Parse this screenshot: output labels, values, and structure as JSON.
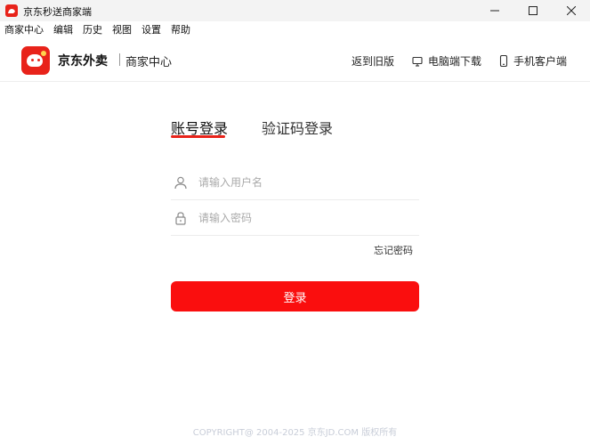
{
  "window": {
    "title": "京东秒送商家端",
    "controls": [
      "minimize-icon",
      "maximize-icon",
      "close-icon"
    ]
  },
  "menu": {
    "items": [
      "商家中心",
      "编辑",
      "历史",
      "视图",
      "设置",
      "帮助"
    ]
  },
  "header": {
    "brand": "京东外卖",
    "subtitle": "商家中心",
    "links": {
      "old_version": "返到旧版",
      "desktop_download": "电脑端下载",
      "mobile_client": "手机客户端"
    }
  },
  "login": {
    "tabs": {
      "account": "账号登录",
      "code": "验证码登录"
    },
    "username_placeholder": "请输入用户名",
    "password_placeholder": "请输入密码",
    "forgot_password": "忘记密码",
    "submit": "登录"
  },
  "footer": {
    "copyright": "COPYRIGHT@ 2004-2025 京东JD.COM 版权所有"
  },
  "colors": {
    "accent": "#e8231a",
    "button": "#fa0e0e",
    "footer_text": "#c8cdd8"
  }
}
